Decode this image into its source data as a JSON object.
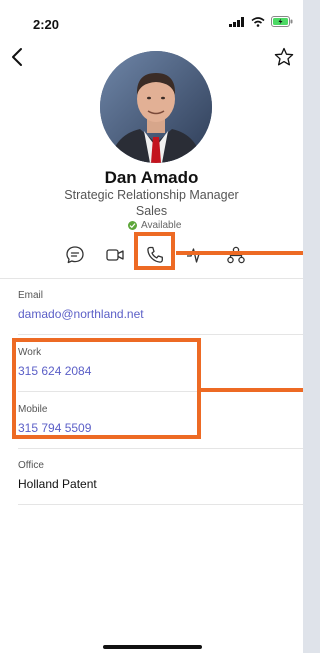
{
  "status": {
    "time": "2:20"
  },
  "profile": {
    "name": "Dan Amado",
    "title": "Strategic Relationship Manager",
    "department": "Sales",
    "presence": "Available"
  },
  "actions": [
    {
      "icon": "chat-icon"
    },
    {
      "icon": "video-icon"
    },
    {
      "icon": "phone-icon"
    },
    {
      "icon": "activity-icon"
    },
    {
      "icon": "org-chart-icon"
    }
  ],
  "fields": {
    "email": {
      "label": "Email",
      "value": "damado@northland.net"
    },
    "work": {
      "label": "Work",
      "value": "315 624 2084"
    },
    "mobile": {
      "label": "Mobile",
      "value": "315 794 5509"
    },
    "office": {
      "label": "Office",
      "value": "Holland Patent"
    }
  },
  "colors": {
    "link": "#5b5fc7",
    "highlight": "#ed6a24",
    "presence": "#5da63a"
  }
}
